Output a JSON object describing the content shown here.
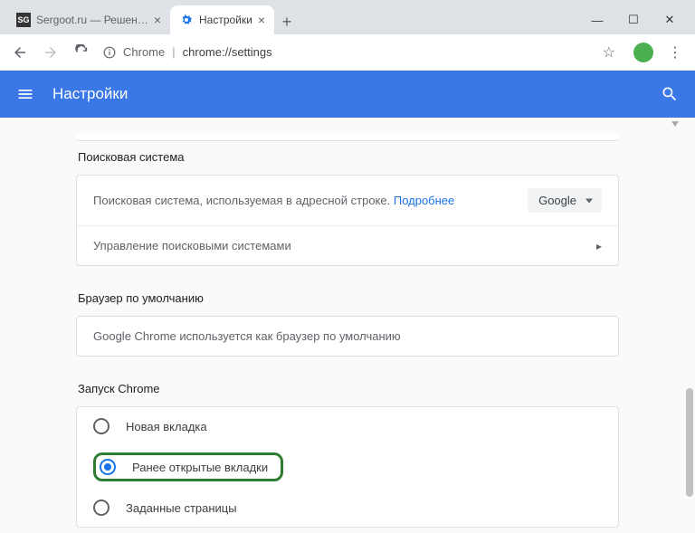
{
  "window": {
    "tabs": [
      {
        "title": "Sergoot.ru — Решение ваших п...",
        "active": false
      },
      {
        "title": "Настройки",
        "active": true
      }
    ],
    "url_prefix": "Chrome",
    "url_path": "chrome://settings"
  },
  "header": {
    "title": "Настройки"
  },
  "sections": {
    "search": {
      "title": "Поисковая система",
      "engine_label": "Поисковая система, используемая в адресной строке.",
      "more_link": "Подробнее",
      "selected_engine": "Google",
      "manage_label": "Управление поисковыми системами"
    },
    "default": {
      "title": "Браузер по умолчанию",
      "text": "Google Chrome используется как браузер по умолчанию"
    },
    "startup": {
      "title": "Запуск Chrome",
      "options": [
        {
          "label": "Новая вкладка",
          "checked": false,
          "highlight": false
        },
        {
          "label": "Ранее открытые вкладки",
          "checked": true,
          "highlight": true
        },
        {
          "label": "Заданные страницы",
          "checked": false,
          "highlight": false
        }
      ]
    }
  }
}
